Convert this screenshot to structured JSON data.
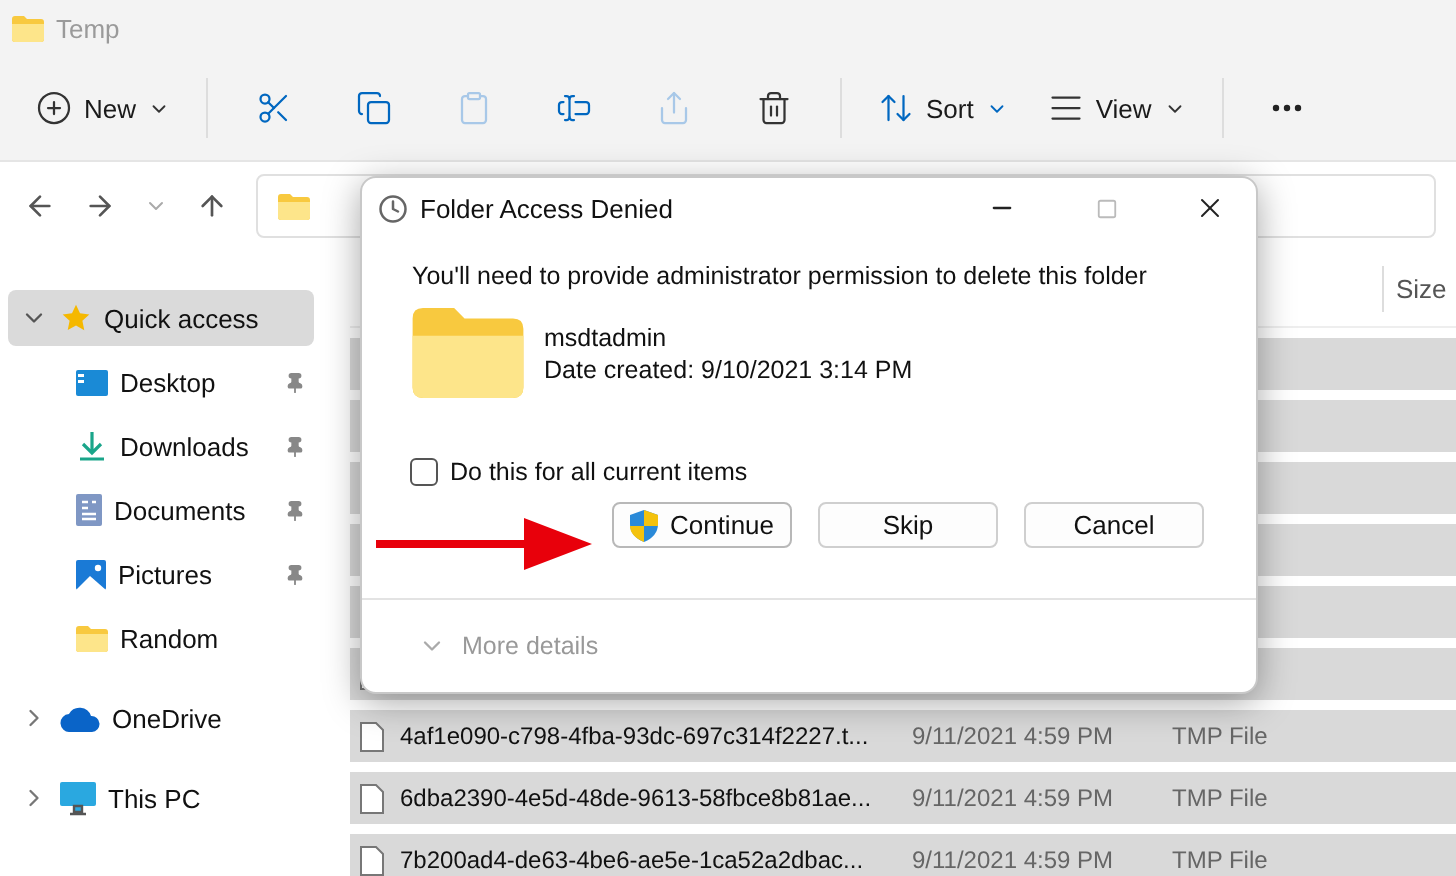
{
  "window": {
    "title": "Temp"
  },
  "toolbar": [
    {
      "kind": "new",
      "label": "New"
    },
    {
      "kind": "cut"
    },
    {
      "kind": "copy"
    },
    {
      "kind": "paste",
      "disabled": true
    },
    {
      "kind": "rename"
    },
    {
      "kind": "share",
      "disabled": true
    },
    {
      "kind": "delete"
    },
    {
      "kind": "sort",
      "label": "Sort"
    },
    {
      "kind": "view",
      "label": "View"
    },
    {
      "kind": "more"
    }
  ],
  "sidebar": {
    "items": [
      {
        "label": "Quick access",
        "kind": "star",
        "expanded": true,
        "selected": true,
        "children": [
          {
            "label": "Desktop",
            "kind": "desktop",
            "pinned": true,
            "selected": false
          },
          {
            "label": "Downloads",
            "kind": "download",
            "pinned": true,
            "selected": false
          },
          {
            "label": "Documents",
            "kind": "document",
            "pinned": true,
            "selected": false
          },
          {
            "label": "Pictures",
            "kind": "picture",
            "pinned": true,
            "selected": false
          },
          {
            "label": "Random",
            "kind": "folder",
            "pinned": false,
            "selected": false
          }
        ]
      },
      {
        "label": "OneDrive",
        "kind": "cloud",
        "expanded": false,
        "selected": false
      },
      {
        "label": "This PC",
        "kind": "pc",
        "expanded": false,
        "selected": false
      }
    ]
  },
  "file_list": {
    "columns": [
      {
        "label": "Size"
      }
    ],
    "rows": [
      {
        "selected": true
      },
      {
        "selected": true
      },
      {
        "selected": true
      },
      {
        "selected": true
      },
      {
        "selected": true
      },
      {
        "selected": true
      },
      {
        "name": "4af1e090-c798-4fba-93dc-697c314f2227.t...",
        "date": "9/11/2021 4:59 PM",
        "type": "TMP File",
        "selected": true
      },
      {
        "name": "6dba2390-4e5d-48de-9613-58fbce8b81ae...",
        "date": "9/11/2021 4:59 PM",
        "type": "TMP File",
        "selected": true
      },
      {
        "name": "7b200ad4-de63-4be6-ae5e-1ca52a2dbac...",
        "date": "9/11/2021 4:59 PM",
        "type": "TMP File",
        "selected": true
      }
    ]
  },
  "dialog": {
    "title": "Folder Access Denied",
    "message": "You'll need to provide administrator permission to delete this folder",
    "item": {
      "name": "msdtadmin",
      "date": "Date created: 9/10/2021 3:14 PM"
    },
    "checkbox": {
      "label": "Do this for all current items",
      "checked": false
    },
    "buttons": [
      {
        "label": "Continue",
        "shield": true,
        "highlighted": true
      },
      {
        "label": "Skip",
        "shield": false,
        "highlighted": false
      },
      {
        "label": "Cancel",
        "shield": false,
        "highlighted": false
      }
    ],
    "more_details": {
      "label": "More details",
      "expanded": false
    }
  }
}
